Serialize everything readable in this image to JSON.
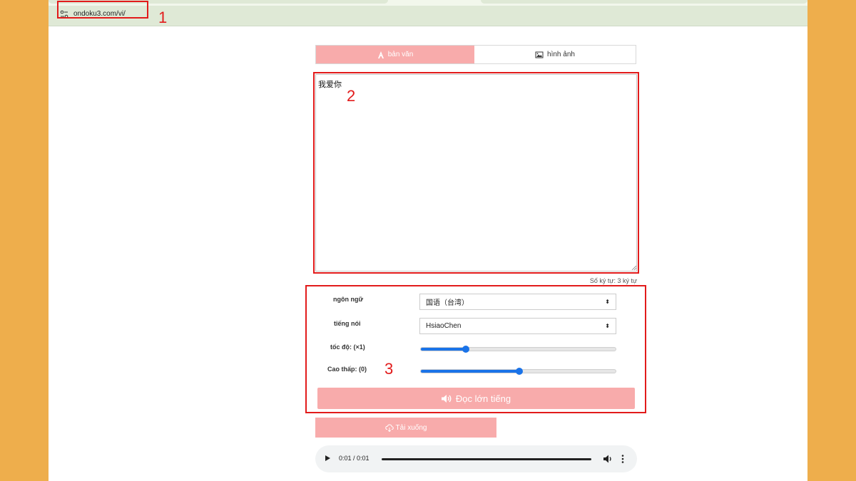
{
  "browser": {
    "url": "ondoku3.com/vi/"
  },
  "callouts": [
    "1",
    "2",
    "3"
  ],
  "tabs": {
    "text_label": "bản văn",
    "image_label": "hình ảnh"
  },
  "editor": {
    "value": "我爱你",
    "char_count": "Số ký tự: 3 ký tự"
  },
  "settings": {
    "language_label": "ngôn ngữ",
    "language_value": "国语（台湾）",
    "voice_label": "tiếng nói",
    "voice_value": "HsiaoChen",
    "speed_label": "tốc độ: (×1)",
    "speed_level": 0.22,
    "pitch_label": "Cao thấp: (0)",
    "pitch_level": 0.5
  },
  "actions": {
    "read_label": "Đọc lớn tiếng",
    "download_label": "Tải xuống"
  },
  "audio": {
    "time": "0:01 / 0:01"
  },
  "colors": {
    "accent_pink": "#f8abab",
    "highlight_red": "#e21b1b",
    "slider_blue": "#1a73e8",
    "background_orange": "#EEAE4C"
  }
}
